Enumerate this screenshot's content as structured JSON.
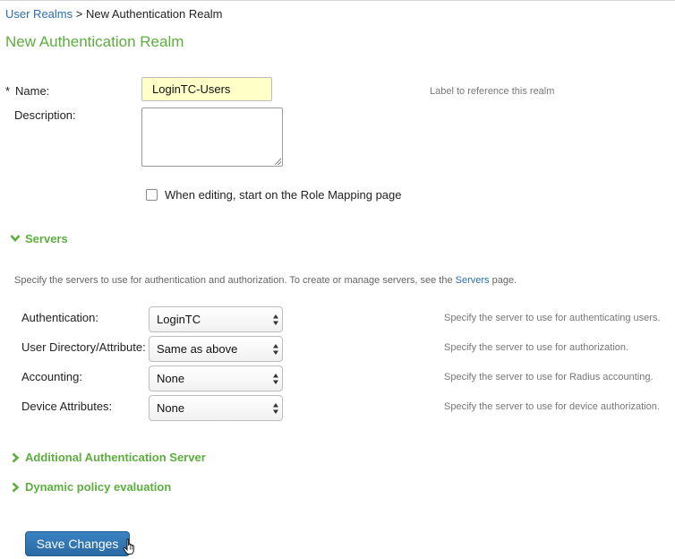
{
  "breadcrumb": {
    "parent": "User Realms",
    "separator": " > ",
    "current": "New Authentication Realm"
  },
  "page_title": "New Authentication Realm",
  "form": {
    "name": {
      "required_mark": "*",
      "label": "Name:",
      "value": "LoginTC-Users",
      "hint": "Label to reference this realm"
    },
    "description": {
      "label": "Description:",
      "value": ""
    },
    "role_mapping_checkbox": {
      "label": "When editing, start on the Role Mapping page",
      "checked": false
    }
  },
  "servers": {
    "heading": "Servers",
    "expanded": true,
    "intro_before": "Specify the servers to use for authentication and authorization. To create or manage servers, see the ",
    "intro_link": "Servers",
    "intro_after": " page.",
    "rows": [
      {
        "label": "Authentication:",
        "value": "LoginTC",
        "hint": "Specify the server to use for authenticating users."
      },
      {
        "label": "User Directory/Attribute:",
        "value": "Same as above",
        "hint": "Specify the server to use for authorization."
      },
      {
        "label": "Accounting:",
        "value": "None",
        "hint": "Specify the server to use for Radius accounting."
      },
      {
        "label": "Device Attributes:",
        "value": "None",
        "hint": "Specify the server to use for device authorization."
      }
    ]
  },
  "collapsed_sections": [
    {
      "heading": "Additional Authentication Server",
      "expanded": false
    },
    {
      "heading": "Dynamic policy evaluation",
      "expanded": false
    }
  ],
  "actions": {
    "save_label": "Save Changes"
  },
  "colors": {
    "accent_green": "#5cae3f",
    "link_blue": "#2a6fb0",
    "button_blue": "#2f73b3",
    "input_highlight": "#ffffc8"
  },
  "icons": {
    "servers_toggle": "chevron-down-icon",
    "collapsed_toggle": "chevron-right-icon",
    "select_arrows": "sort-arrows-icon",
    "cursor": "hand-pointer-icon"
  }
}
